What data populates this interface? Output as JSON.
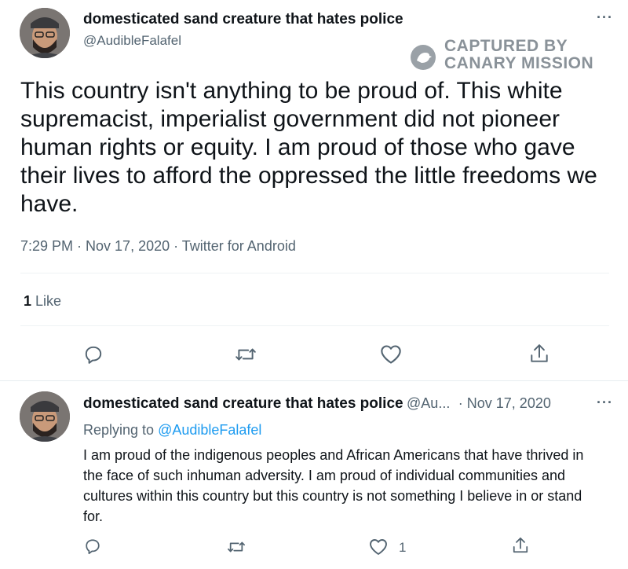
{
  "main_tweet": {
    "display_name": "domesticated sand creature that hates police",
    "handle": "@AudibleFalafel",
    "text": "This country isn't anything to be proud of. This white supremacist, imperialist government did not pioneer human rights or equity. I am proud of those who gave their lives to afford the oppressed the little freedoms we have.",
    "timestamp": "7:29 PM · Nov 17, 2020 · Twitter for Android",
    "like_count": "1",
    "like_label": "Like",
    "more_label": "···"
  },
  "watermark": {
    "line1": "CAPTURED BY",
    "line2": "CANARY MISSION",
    "icon": "canary-bird-icon"
  },
  "reply_tweet": {
    "display_name": "domesticated sand creature that hates police",
    "handle_truncated": "@Au...",
    "date": "· Nov 17, 2020",
    "replying_prefix": "Replying to",
    "replying_handle": "@AudibleFalafel",
    "text": "I am proud of the indigenous peoples and African Americans that have thrived in the face of such inhuman adversity. I am proud of individual communities and cultures within this country but this country is not something I believe in or stand for.",
    "like_count": "1",
    "more_label": "···"
  },
  "icons": {
    "reply": "reply-icon",
    "retweet": "retweet-icon",
    "like": "heart-icon",
    "share": "share-icon"
  },
  "colors": {
    "text": "#0f1419",
    "secondary": "#536471",
    "link": "#1d9bf0",
    "divider": "#eff3f4"
  }
}
